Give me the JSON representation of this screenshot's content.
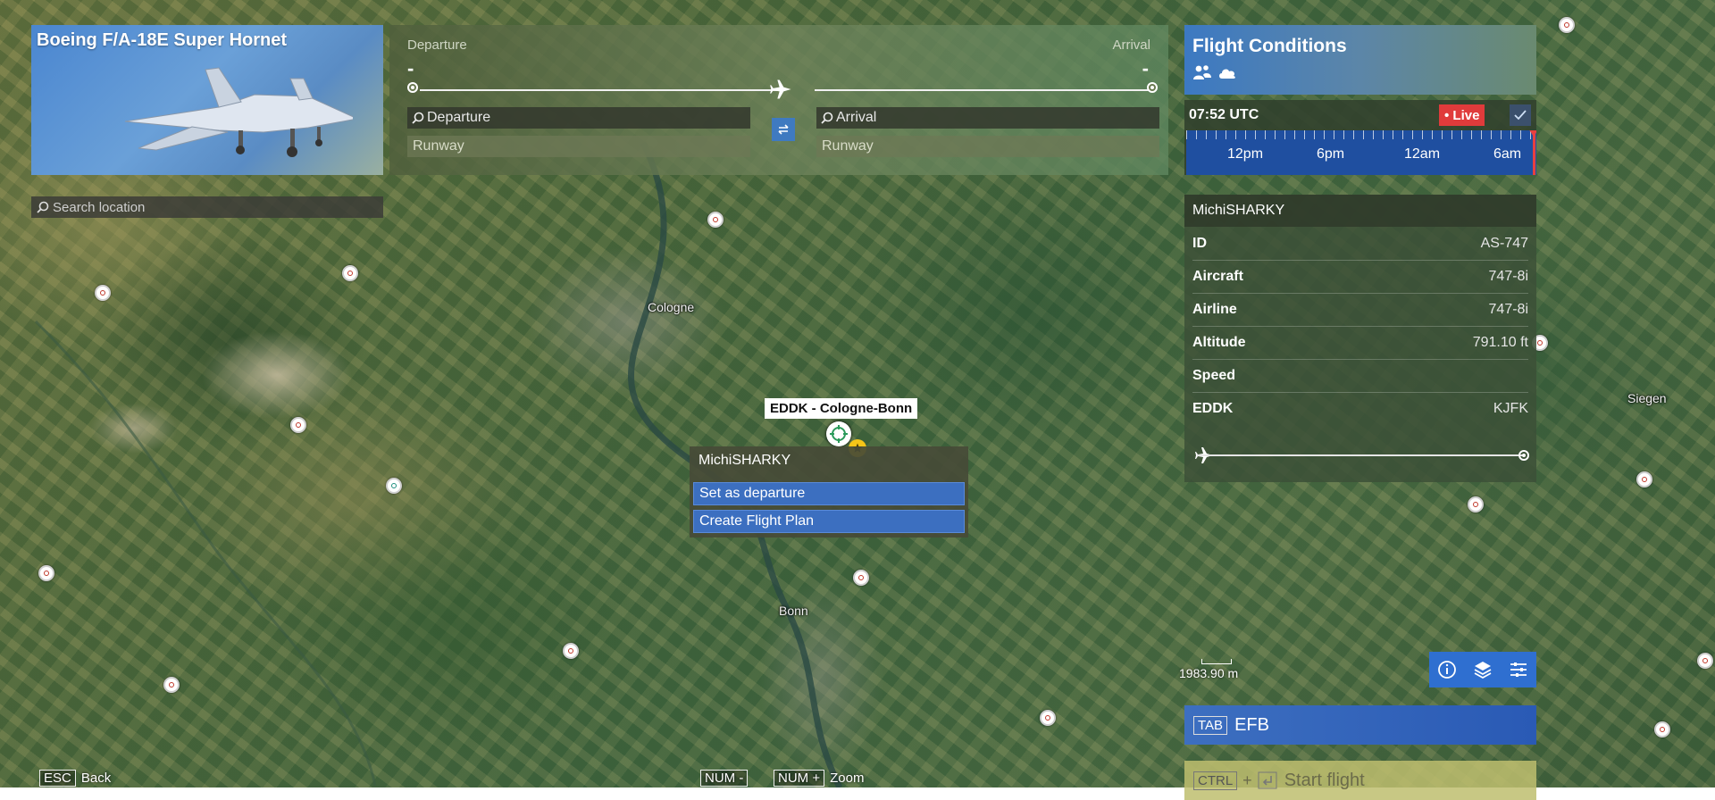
{
  "aircraft": {
    "title": "Boeing F/A-18E Super Hornet"
  },
  "search": {
    "placeholder": "Search location"
  },
  "route": {
    "departure_label": "Departure",
    "arrival_label": "Arrival",
    "departure_value": "-",
    "arrival_value": "-",
    "departure_placeholder": "Departure",
    "arrival_placeholder": "Arrival",
    "departure_runway": "Runway",
    "arrival_runway": "Runway"
  },
  "conditions": {
    "title": "Flight Conditions",
    "time": "07:52 UTC",
    "live_label": "• Live",
    "timeline_labels": [
      "12pm",
      "6pm",
      "12am",
      "6am"
    ]
  },
  "info": {
    "header": "MichiSHARKY",
    "rows": [
      {
        "key": "ID",
        "value": "AS-747"
      },
      {
        "key": "Aircraft",
        "value": "747-8i"
      },
      {
        "key": "Airline",
        "value": "747-8i"
      },
      {
        "key": "Altitude",
        "value": "791.10 ft"
      },
      {
        "key": "Speed",
        "value": ""
      },
      {
        "key": "EDDK",
        "value": "KJFK"
      }
    ]
  },
  "map": {
    "cities": [
      "Cologne",
      "Bonn",
      "Siegen"
    ],
    "scale": "1983.90 m",
    "airport_label": "EDDK - Cologne-Bonn"
  },
  "context_menu": {
    "title": "MichiSHARKY",
    "items": [
      "Set as departure",
      "Create Flight Plan"
    ]
  },
  "efb": {
    "key": "TAB",
    "label": "EFB"
  },
  "start_flight": {
    "key": "CTRL",
    "plus": "+",
    "label": "Start flight"
  },
  "hints": {
    "back_key": "ESC",
    "back_label": "Back",
    "zoom_out_key": "NUM -",
    "zoom_in_key": "NUM +",
    "zoom_label": "Zoom"
  },
  "colors": {
    "accent": "#3c6fc0",
    "live": "#e03b3b",
    "timeline": "#1f4fa0"
  }
}
